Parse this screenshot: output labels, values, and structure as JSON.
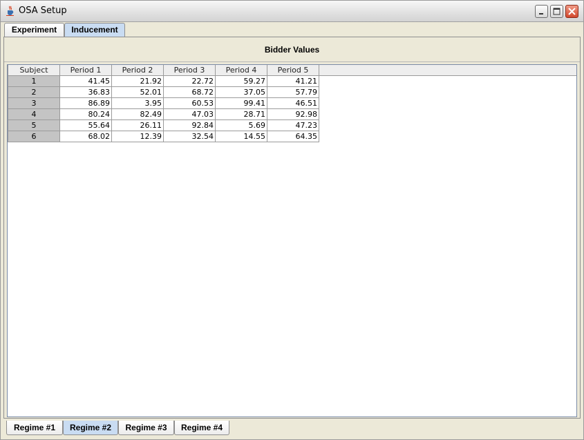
{
  "window": {
    "title": "OSA Setup"
  },
  "top_tabs": [
    "Experiment",
    "Inducement"
  ],
  "active_top_tab": "Inducement",
  "panel": {
    "title": "Bidder Values"
  },
  "table": {
    "columns": [
      "Subject",
      "Period 1",
      "Period 2",
      "Period 3",
      "Period 4",
      "Period 5"
    ],
    "rows": [
      [
        "1",
        "41.45",
        "21.92",
        "22.72",
        "59.27",
        "41.21"
      ],
      [
        "2",
        "36.83",
        "52.01",
        "68.72",
        "37.05",
        "57.79"
      ],
      [
        "3",
        "86.89",
        "3.95",
        "60.53",
        "99.41",
        "46.51"
      ],
      [
        "4",
        "80.24",
        "82.49",
        "47.03",
        "28.71",
        "92.98"
      ],
      [
        "5",
        "55.64",
        "26.11",
        "92.84",
        "5.69",
        "47.23"
      ],
      [
        "6",
        "68.02",
        "12.39",
        "32.54",
        "14.55",
        "64.35"
      ]
    ]
  },
  "bottom_tabs": [
    "Regime #1",
    "Regime #2",
    "Regime #3",
    "Regime #4"
  ],
  "active_bottom_tab": "Regime #2",
  "icons": {
    "app": "java-cup-icon",
    "minimize": "minimize-icon",
    "maximize": "maximize-icon",
    "close": "close-icon"
  }
}
